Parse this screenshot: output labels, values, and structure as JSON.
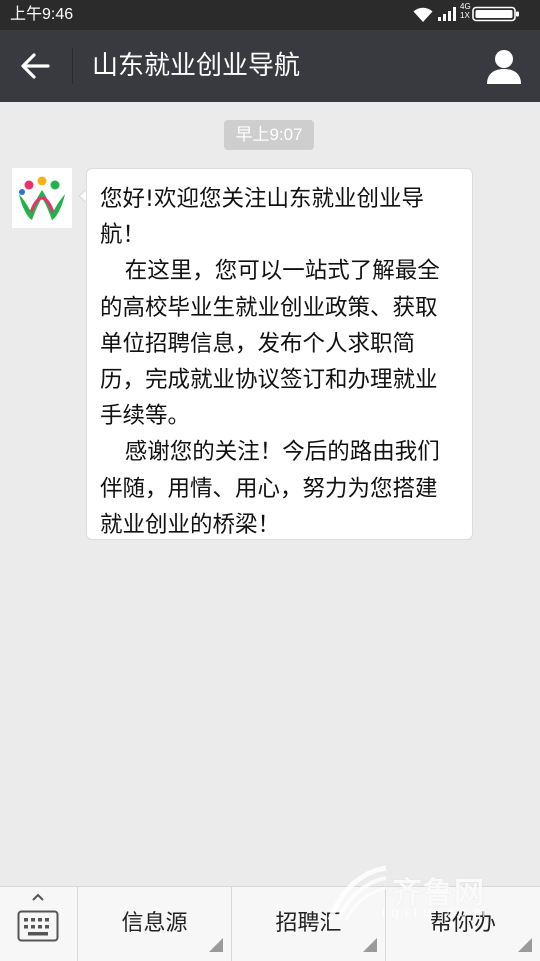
{
  "status_bar": {
    "time": "上午9:46",
    "network_top": "4G",
    "network_bottom": "1X",
    "icons": [
      "wifi-icon",
      "signal-icon",
      "battery-icon"
    ]
  },
  "header": {
    "title": "山东就业创业导航",
    "back_icon": "back-arrow-icon",
    "profile_icon": "profile-icon",
    "bg_color": "#393a3f"
  },
  "chat": {
    "timestamp": "早上9:07",
    "message": {
      "avatar_icon": "account-logo",
      "paragraphs": [
        "您好!欢迎您关注山东就业创业导航！",
        "在这里，您可以一站式了解最全的高校毕业生就业创业政策、获取单位招聘信息，发布个人求职简历，完成就业协议签订和办理就业手续等。",
        "感谢您的关注！今后的路由我们伴随，用情、用心，努力为您搭建就业创业的桥梁！"
      ]
    }
  },
  "bottom_menu": {
    "keyboard_icon": "keyboard-icon",
    "items": [
      {
        "label": "信息源"
      },
      {
        "label": "招聘汇"
      },
      {
        "label": "帮你办"
      }
    ]
  },
  "watermark": {
    "text": "齐鲁网",
    "sub": "iqilu.com"
  }
}
